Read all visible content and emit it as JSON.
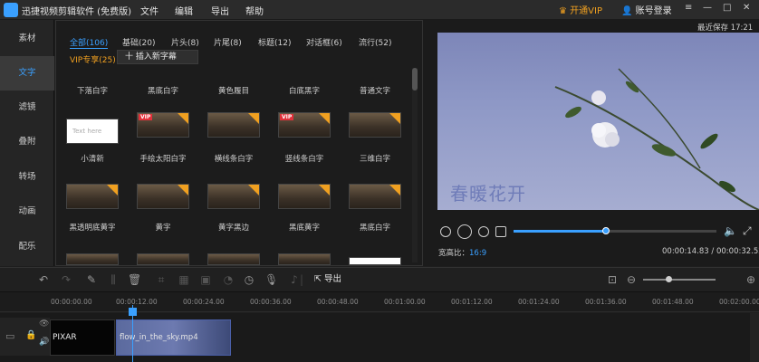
{
  "app": {
    "title": "迅捷视频剪辑软件 (免费版)",
    "menu": [
      "文件",
      "编辑",
      "导出",
      "帮助"
    ],
    "vip_label": "开通VIP",
    "account_label": "账号登录",
    "window_buttons": [
      "≡",
      "—",
      "□",
      "✕"
    ]
  },
  "sidebar": {
    "items": [
      {
        "label": "素材"
      },
      {
        "label": "文字"
      },
      {
        "label": "滤镜"
      },
      {
        "label": "叠附"
      },
      {
        "label": "转场"
      },
      {
        "label": "动画"
      },
      {
        "label": "配乐"
      }
    ],
    "active": "文字"
  },
  "library": {
    "tabs": [
      {
        "label": "全部(106)"
      },
      {
        "label": "基础(20)"
      },
      {
        "label": "片头(8)"
      },
      {
        "label": "片尾(8)"
      },
      {
        "label": "标题(12)"
      },
      {
        "label": "对话框(6)"
      },
      {
        "label": "流行(52)"
      },
      {
        "label": "VIP专享(25)"
      }
    ],
    "insert_button": "十 插入新字幕",
    "row1_captions": [
      "下落白字",
      "黑底白字",
      "黄色履目",
      "白底黑字",
      "普通文字"
    ],
    "row2_captions": [
      "小清新",
      "手绘太阳白字",
      "横线条白字",
      "竖线条白字",
      "三维白字"
    ],
    "row3_captions": [
      "黑透明底黄字",
      "黄字",
      "黄字黑边",
      "黑底黄字",
      "黑底白字"
    ],
    "thumb_text": "Text here",
    "vip_badge": "VIP"
  },
  "preview": {
    "recent_save": "最近保存 17:21",
    "caption_text": "春暖花开",
    "ratio_label": "宽高比：",
    "ratio_value": "16:9",
    "current_time": "00:00:14.83",
    "total_time": "00:00:32.52",
    "time_separator": " / ",
    "progress": 0.456
  },
  "toolbar": {
    "export_label": "导出",
    "zoom_level": 0.35
  },
  "timeline": {
    "ruler_labels": [
      "00:00:00.00",
      "00:00:12.00",
      "00:00:24.00",
      "00:00:36.00",
      "00:00:48.00",
      "00:01:00.00",
      "00:01:12.00",
      "00:01:24.00",
      "00:01:36.00",
      "00:01:48.00",
      "00:02:00.00"
    ],
    "clips": [
      {
        "name": "PIXAR"
      },
      {
        "name": "flow_in_the_sky.mp4"
      }
    ]
  },
  "colors": {
    "accent": "#3aa0ff",
    "vip": "#f0a020",
    "background": "#1e1e1e"
  }
}
